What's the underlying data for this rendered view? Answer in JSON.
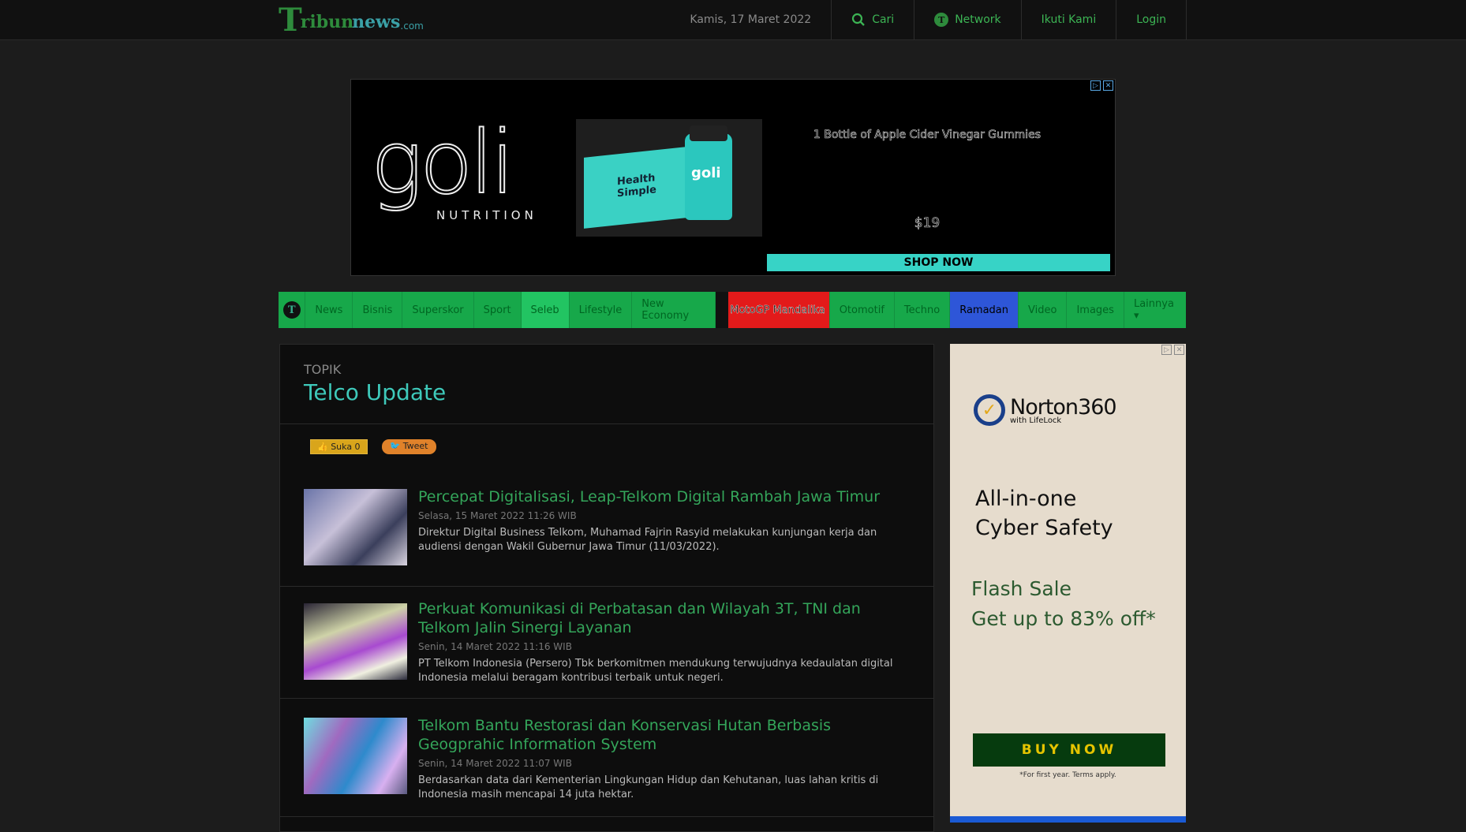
{
  "header": {
    "logo_big": "T",
    "logo_ribun": "ribun",
    "logo_news": "news",
    "logo_dom": ".com",
    "date": "Kamis, 17 Maret 2022",
    "search_label": "Cari",
    "network_label": "Network",
    "follow_label": "Ikuti Kami",
    "login_label": "Login"
  },
  "top_ad": {
    "brand": "goli",
    "brand_sub": "NUTRITION",
    "box_text": "Health Simple",
    "bottle_label": "goli",
    "title": "1 Bottle of Apple Cider Vinegar Gummies",
    "price": "$19",
    "cta": "SHOP NOW"
  },
  "nav": {
    "items": [
      "News",
      "Bisnis",
      "Superskor",
      "Sport",
      "Seleb",
      "Lifestyle",
      "New Economy",
      "MotoGP Mandalika",
      "Otomotif",
      "Techno",
      "Ramadan",
      "Video",
      "Images",
      "Lainnya ▾"
    ],
    "active": "Seleb"
  },
  "topic": {
    "label": "TOPIK",
    "title": "Telco Update"
  },
  "social": {
    "like": "👍 Suka 0",
    "tweet": "🐦 Tweet"
  },
  "articles": [
    {
      "title": "Percepat Digitalisasi, Leap-Telkom Digital Rambah Jawa Timur",
      "date": "Selasa, 15 Maret 2022 11:26 WIB",
      "desc": "Direktur Digital Business Telkom, Muhamad Fajrin Rasyid melakukan kunjungan kerja dan audiensi dengan Wakil Gubernur Jawa Timur (11/03/2022)."
    },
    {
      "title": "Perkuat Komunikasi di Perbatasan dan Wilayah 3T, TNI dan Telkom Jalin Sinergi Layanan",
      "date": "Senin, 14 Maret 2022 11:16 WIB",
      "desc": "PT Telkom Indonesia (Persero) Tbk berkomitmen mendukung terwujudnya kedaulatan digital Indonesia melalui beragam kontribusi terbaik untuk negeri."
    },
    {
      "title": "Telkom Bantu Restorasi dan Konservasi Hutan Berbasis Geogprahic Information System",
      "date": "Senin, 14 Maret 2022 11:07 WIB",
      "desc": "Berdasarkan data dari Kementerian Lingkungan Hidup dan Kehutanan, luas lahan kritis di Indonesia masih mencapai 14 juta hektar."
    }
  ],
  "side_ad": {
    "brand": "Norton360",
    "brand_sub": "with LifeLock",
    "headline_1": "All-in-one",
    "headline_2": "Cyber Safety",
    "offer_1": "Flash Sale",
    "offer_2": "Get up to 83% off*",
    "cta": "BUY NOW",
    "fine": "*For first year. Terms apply."
  },
  "colors": {
    "accent_green": "#17a84a",
    "topic_title": "#3ec9ba",
    "article_title": "#34a55a"
  }
}
